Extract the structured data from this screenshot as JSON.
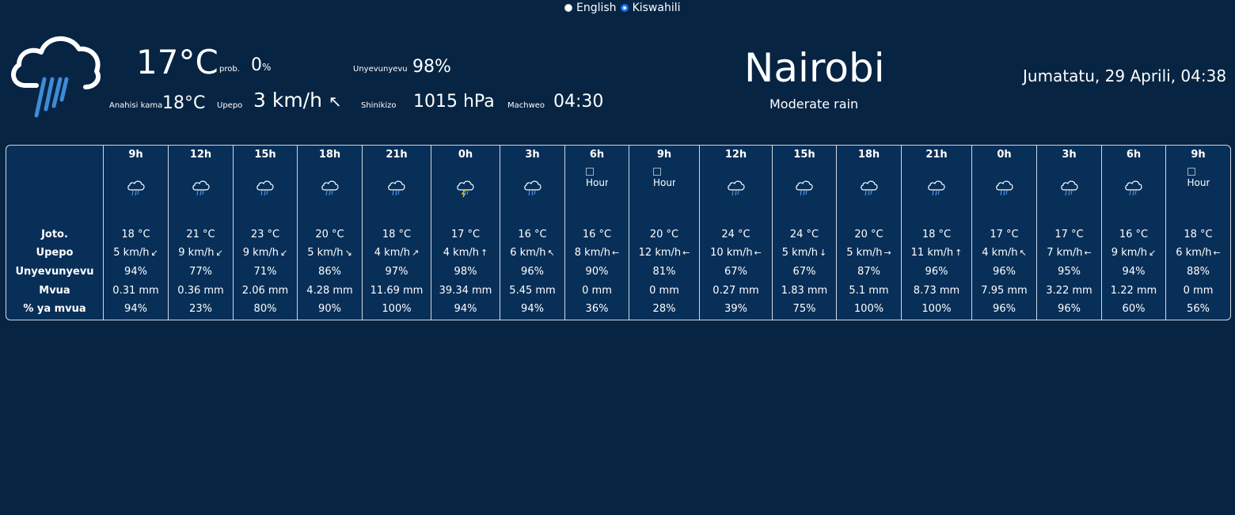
{
  "language": {
    "options": [
      {
        "label": "English",
        "selected": false
      },
      {
        "label": "Kiswahili",
        "selected": true
      }
    ]
  },
  "current": {
    "icon": "rain-cloud-icon",
    "temperature": "17°C",
    "prob_label": "prob.",
    "prob_value": "0",
    "prob_unit": "%",
    "humidity_label": "Unyevunyevu",
    "humidity_value": "98%",
    "feels_like_label": "Anahisi kama",
    "feels_like_value": "18°C",
    "wind_label": "Upepo",
    "wind_value": "3 km/h",
    "wind_arrow": "↖",
    "pressure_label": "Shinikizo",
    "pressure_value": "1015 hPa",
    "sunset_label": "Machweo",
    "sunset_value": "04:30"
  },
  "location": {
    "city": "Nairobi",
    "description": "Moderate rain",
    "datetime": "Jumatatu, 29 Aprili, 04:38"
  },
  "forecast": {
    "row_labels": [
      "Joto.",
      "Upepo",
      "Unyevunyevu",
      "Mvua",
      "% ya mvua"
    ],
    "broken_image_alt": "Hourly",
    "colors": {
      "rain_icon": "#4a90d9",
      "lightning": "#f5c518"
    },
    "columns": [
      {
        "hour": "9h",
        "icon": "rain",
        "temp": "18 °C",
        "wind": "5 km/h",
        "arrow": "↙",
        "humidity": "94%",
        "rain": "0.31 mm",
        "chance": "94%"
      },
      {
        "hour": "12h",
        "icon": "rain",
        "temp": "21 °C",
        "wind": "9 km/h",
        "arrow": "↙",
        "humidity": "77%",
        "rain": "0.36 mm",
        "chance": "23%"
      },
      {
        "hour": "15h",
        "icon": "rain",
        "temp": "23 °C",
        "wind": "9 km/h",
        "arrow": "↙",
        "humidity": "71%",
        "rain": "2.06 mm",
        "chance": "80%"
      },
      {
        "hour": "18h",
        "icon": "rain",
        "temp": "20 °C",
        "wind": "5 km/h",
        "arrow": "↘",
        "humidity": "86%",
        "rain": "4.28 mm",
        "chance": "90%"
      },
      {
        "hour": "21h",
        "icon": "rain",
        "temp": "18 °C",
        "wind": "4 km/h",
        "arrow": "↗",
        "humidity": "97%",
        "rain": "11.69 mm",
        "chance": "100%"
      },
      {
        "hour": "0h",
        "icon": "thunder",
        "temp": "17 °C",
        "wind": "4 km/h",
        "arrow": "↑",
        "humidity": "98%",
        "rain": "39.34 mm",
        "chance": "94%"
      },
      {
        "hour": "3h",
        "icon": "rain",
        "temp": "16 °C",
        "wind": "6 km/h",
        "arrow": "↖",
        "humidity": "96%",
        "rain": "5.45 mm",
        "chance": "94%"
      },
      {
        "hour": "6h",
        "icon": "broken",
        "temp": "16 °C",
        "wind": "8 km/h",
        "arrow": "←",
        "humidity": "90%",
        "rain": "0 mm",
        "chance": "36%"
      },
      {
        "hour": "9h",
        "icon": "broken",
        "temp": "20 °C",
        "wind": "12 km/h",
        "arrow": "←",
        "humidity": "81%",
        "rain": "0 mm",
        "chance": "28%"
      },
      {
        "hour": "12h",
        "icon": "rain",
        "temp": "24 °C",
        "wind": "10 km/h",
        "arrow": "←",
        "humidity": "67%",
        "rain": "0.27 mm",
        "chance": "39%"
      },
      {
        "hour": "15h",
        "icon": "rain",
        "temp": "24 °C",
        "wind": "5 km/h",
        "arrow": "↓",
        "humidity": "67%",
        "rain": "1.83 mm",
        "chance": "75%"
      },
      {
        "hour": "18h",
        "icon": "rain",
        "temp": "20 °C",
        "wind": "5 km/h",
        "arrow": "→",
        "humidity": "87%",
        "rain": "5.1 mm",
        "chance": "100%"
      },
      {
        "hour": "21h",
        "icon": "rain",
        "temp": "18 °C",
        "wind": "11 km/h",
        "arrow": "↑",
        "humidity": "96%",
        "rain": "8.73 mm",
        "chance": "100%"
      },
      {
        "hour": "0h",
        "icon": "rain",
        "temp": "17 °C",
        "wind": "4 km/h",
        "arrow": "↖",
        "humidity": "96%",
        "rain": "7.95 mm",
        "chance": "96%"
      },
      {
        "hour": "3h",
        "icon": "rain",
        "temp": "17 °C",
        "wind": "7 km/h",
        "arrow": "←",
        "humidity": "95%",
        "rain": "3.22 mm",
        "chance": "96%"
      },
      {
        "hour": "6h",
        "icon": "rain",
        "temp": "16 °C",
        "wind": "9 km/h",
        "arrow": "↙",
        "humidity": "94%",
        "rain": "1.22 mm",
        "chance": "60%"
      },
      {
        "hour": "9h",
        "icon": "broken",
        "temp": "18 °C",
        "wind": "6 km/h",
        "arrow": "←",
        "humidity": "88%",
        "rain": "0 mm",
        "chance": "56%"
      }
    ]
  }
}
